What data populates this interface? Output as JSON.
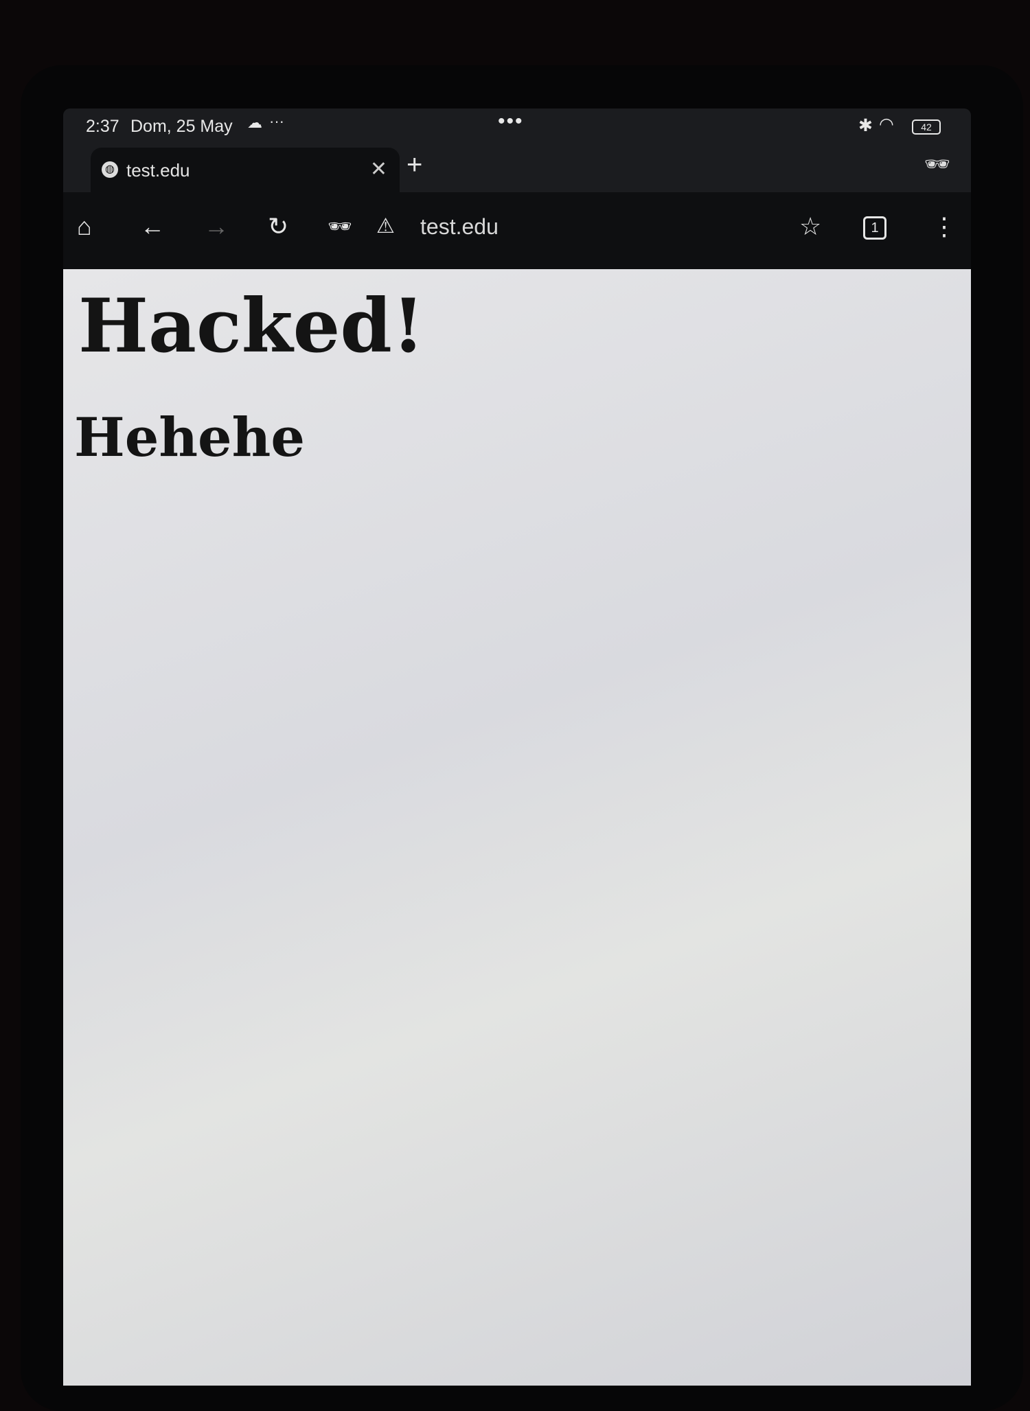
{
  "status_bar": {
    "time": "2:37",
    "date": "Dom, 25 May",
    "more": "···",
    "center_dots": "•••",
    "battery": "42"
  },
  "tab": {
    "title": "test.edu"
  },
  "toolbar": {
    "url": "test.edu",
    "tab_count": "1"
  },
  "page": {
    "heading1": "Hacked!",
    "heading2": "Hehehe"
  }
}
